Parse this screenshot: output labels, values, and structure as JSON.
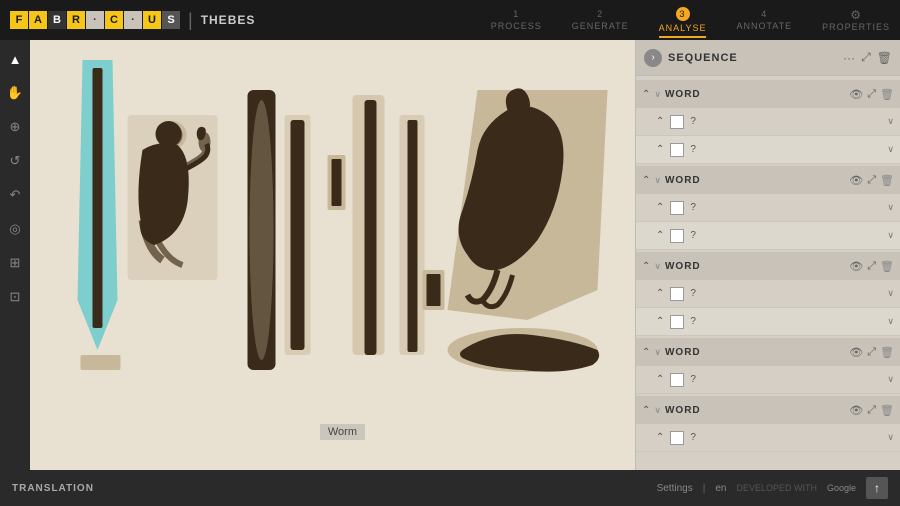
{
  "app": {
    "logo_letters": [
      "F",
      "A",
      "B",
      "R",
      "I",
      "C",
      "I",
      "U",
      "S"
    ],
    "logo_colors": [
      "yellow",
      "yellow",
      "dark",
      "yellow",
      "dark",
      "yellow",
      "dark",
      "yellow",
      "dark"
    ],
    "separator": "|",
    "project_name": "THEBES"
  },
  "nav": {
    "steps": [
      {
        "num": "1",
        "label": "PROCESS",
        "active": false
      },
      {
        "num": "2",
        "label": "GENERATE",
        "active": false
      },
      {
        "num": "3",
        "label": "ANALYSE",
        "active": true
      },
      {
        "num": "4",
        "label": "ANNOTATE",
        "active": false
      }
    ],
    "properties_label": "PROPERTIES"
  },
  "toolbar": {
    "tools": [
      "▲",
      "☞",
      "⊕",
      "↺",
      "↶",
      "◎",
      "⊞",
      "⊡"
    ]
  },
  "panel": {
    "title": "SEQUENCE",
    "arrow": "›",
    "word_groups": [
      {
        "label": "WORD",
        "glyphs": [
          {
            "value": "?"
          },
          {
            "value": "?"
          }
        ]
      },
      {
        "label": "WORD",
        "glyphs": [
          {
            "value": "?"
          },
          {
            "value": "?"
          }
        ]
      },
      {
        "label": "WORD",
        "glyphs": [
          {
            "value": "?"
          },
          {
            "value": "?"
          }
        ]
      },
      {
        "label": "WORD",
        "glyphs": [
          {
            "value": "?"
          }
        ]
      },
      {
        "label": "WORD",
        "glyphs": [
          {
            "value": "?"
          }
        ]
      }
    ]
  },
  "bottom": {
    "translation_label": "TRANSLATION",
    "settings_label": "Settings",
    "lang": "en",
    "developed_text": "DEVELOPED WITH",
    "google_text": "Google",
    "up_arrow": "↑"
  },
  "worm_label": "Worm"
}
